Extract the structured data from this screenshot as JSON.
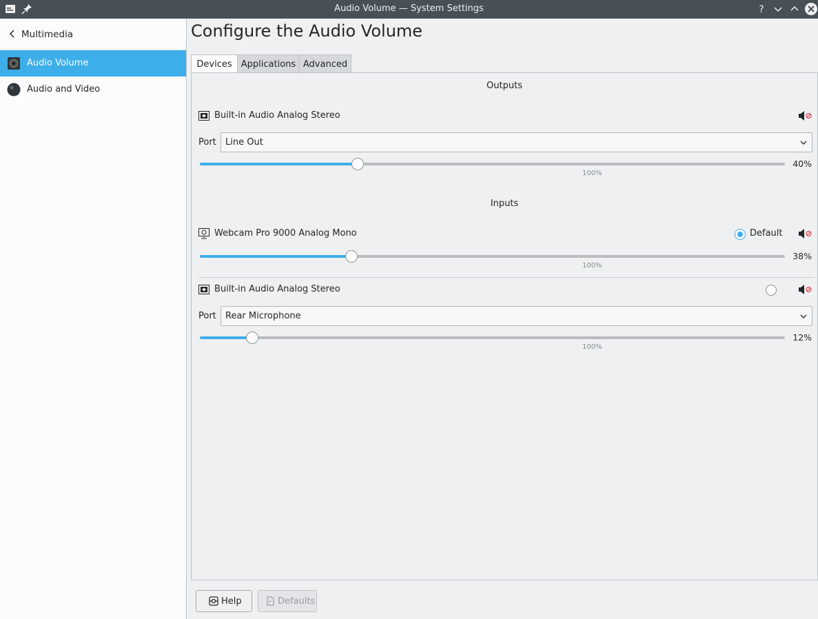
{
  "window": {
    "title": "Audio Volume — System Settings",
    "controls": [
      "help-icon",
      "minimize-icon",
      "maximize-icon",
      "close-icon"
    ]
  },
  "sidebar": {
    "header": "Multimedia",
    "items": [
      {
        "label": "Audio Volume",
        "icon": "speaker-icon",
        "active": true
      },
      {
        "label": "Audio and Video",
        "icon": "phonon-icon",
        "active": false
      }
    ]
  },
  "main": {
    "title": "Configure the Audio Volume",
    "tabs": [
      {
        "label": "Devices",
        "active": true
      },
      {
        "label": "Applications",
        "active": false
      },
      {
        "label": "Advanced",
        "active": false
      }
    ],
    "outputs_title": "Outputs",
    "inputs_title": "Inputs",
    "port_label": "Port",
    "default_label": "Default",
    "hundred_label": "100%",
    "outputs": [
      {
        "name": "Built-in Audio Analog Stereo",
        "port": "Line Out",
        "volume": 40,
        "volume_label": "40%"
      }
    ],
    "inputs": [
      {
        "name": "Webcam Pro 9000 Analog Mono",
        "default": true,
        "volume": 38,
        "volume_label": "38%"
      },
      {
        "name": "Built-in Audio Analog Stereo",
        "default": false,
        "port": "Rear Microphone",
        "volume": 12,
        "volume_label": "12%"
      }
    ]
  },
  "footer": {
    "help_label": "Help",
    "defaults_label": "Defaults"
  },
  "colors": {
    "accent": "#3daee9",
    "titlebar": "#475057",
    "muted_red": "#da4453"
  }
}
